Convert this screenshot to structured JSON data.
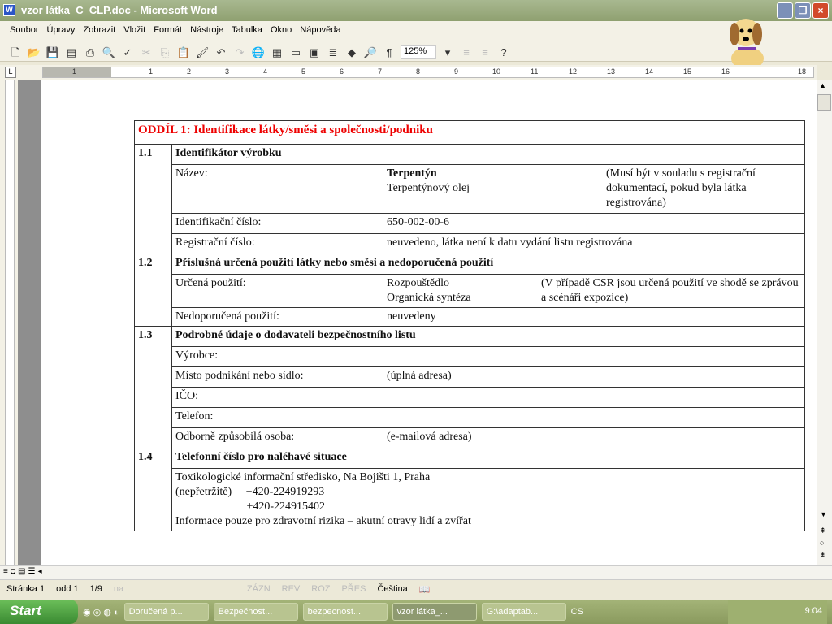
{
  "window": {
    "title": "vzor látka_C_CLP.doc - Microsoft Word"
  },
  "menu": [
    "Soubor",
    "Úpravy",
    "Zobrazit",
    "Vložit",
    "Formát",
    "Nástroje",
    "Tabulka",
    "Okno",
    "Nápověda"
  ],
  "toolbar": {
    "zoom": "125%"
  },
  "ruler": [
    "1",
    "1",
    "2",
    "3",
    "4",
    "5",
    "6",
    "7",
    "8",
    "9",
    "10",
    "11",
    "12",
    "13",
    "14",
    "15",
    "16",
    "18"
  ],
  "doc": {
    "heading": "ODDÍL 1:  Identifikace látky/směsi a společnosti/podniku",
    "s11": {
      "num": "1.1",
      "title": "Identifikátor výrobku",
      "name_label": "Název:",
      "name_value": "Terpentýn",
      "name_value2": "Terpentýnový olej",
      "name_note": "(Musí být v souladu s registrační dokumentací, pokud byla látka registrována)",
      "id_label": "Identifikační číslo:",
      "id_value": "650-002-00-6",
      "reg_label": "Registrační číslo:",
      "reg_value": "neuvedeno, látka není k datu vydání listu registrována"
    },
    "s12": {
      "num": "1.2",
      "title": "Příslušná určená použití látky nebo směsi a nedoporučená použití",
      "use_label": "Určená použití:",
      "use_value": "Rozpouštědlo",
      "use_value2": "Organická syntéza",
      "use_note": "(V případě CSR jsou určená použití ve shodě se zprávou a scénáři expozice)",
      "notrec_label": "Nedoporučená použití:",
      "notrec_value": "neuvedeny"
    },
    "s13": {
      "num": "1.3",
      "title": "Podrobné údaje o dodavateli bezpečnostního listu",
      "rows": [
        [
          "Výrobce:",
          ""
        ],
        [
          "Místo podnikání nebo sídlo:",
          "(úplná adresa)"
        ],
        [
          "IČO:",
          ""
        ],
        [
          "Telefon:",
          ""
        ],
        [
          "Odborně způsobilá osoba:",
          "(e-mailová adresa)"
        ]
      ]
    },
    "s14": {
      "num": "1.4",
      "title": "Telefonní číslo pro naléhavé situace",
      "lines": [
        "Toxikologické informační středisko, Na Bojišti 1, Praha",
        "(nepřetržitě)     +420-224919293",
        "                         +420-224915402",
        "Informace pouze pro zdravotní rizika – akutní otravy lidí a zvířat"
      ]
    }
  },
  "status": {
    "page": "Stránka 1",
    "section": "odd 1",
    "pages": "1/9",
    "at": "na",
    "rec": "ZÁZN",
    "trk": "REV",
    "ext": "ROZ",
    "ovr": "PŘES",
    "lang": "Čeština"
  },
  "taskbar": {
    "start": "Start",
    "tasks": [
      "Doručená p...",
      "Bezpečnost...",
      "bezpecnost...",
      "vzor látka_...",
      "G:\\adaptab..."
    ],
    "lang": "CS",
    "clock": "9:04"
  }
}
